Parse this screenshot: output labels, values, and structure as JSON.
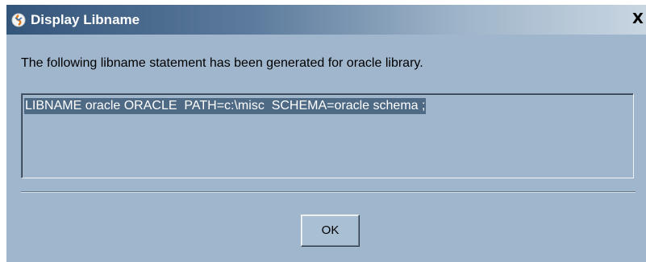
{
  "window": {
    "title": "Display Libname",
    "close_label": "X"
  },
  "message": "The following libname statement has been generated for oracle library.",
  "statement": "LIBNAME oracle ORACLE  PATH=c:\\misc  SCHEMA=oracle schema ;",
  "buttons": {
    "ok_label": "OK"
  },
  "icons": {
    "app": "sas-app-icon",
    "close": "close-icon"
  }
}
